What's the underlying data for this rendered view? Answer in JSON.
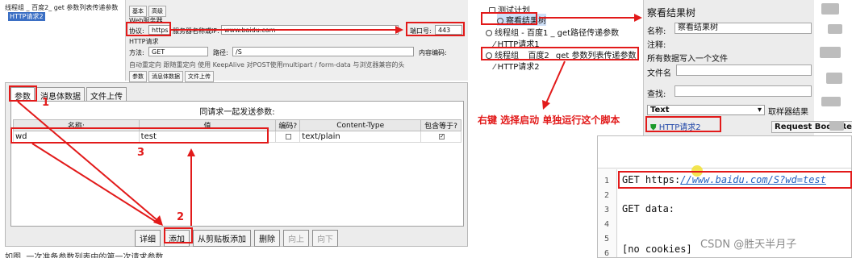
{
  "top_left_tree": {
    "items": [
      "线程组 _ 百度2_ get 参数列表传递参数",
      "HTTP请求2"
    ]
  },
  "config": {
    "tabs": [
      "基本",
      "高级"
    ],
    "web_server_label": "Web服务器",
    "protocol_label": "协议:",
    "protocol_value": "https",
    "server_label": "服务器名称或IP:",
    "server_value": "www.baidu.com",
    "port_label": "端口号:",
    "port_value": "443",
    "http_request_label": "HTTP请求",
    "method_label": "方法:",
    "method_value": "GET",
    "path_label": "路径:",
    "path_value": "/S",
    "encoding_label": "内容编码:",
    "options_text": "自动重定向  跟随重定向  使用 KeepAlive  对POST使用multipart / form-data  与浏览器兼容的头",
    "subtabs": [
      "参数",
      "消息体数据",
      "文件上传"
    ]
  },
  "params": {
    "tabs": [
      "参数",
      "消息体数据",
      "文件上传"
    ],
    "heading": "同请求一起发送参数:",
    "columns": [
      "名称:",
      "值",
      "编码?",
      "Content-Type",
      "包含等于?"
    ],
    "rows": [
      {
        "name": "wd",
        "value": "test",
        "encode": false,
        "content_type": "text/plain",
        "include_equals": true
      }
    ],
    "buttons": [
      "详细",
      "添加",
      "从剪贴板添加",
      "删除",
      "向上",
      "向下"
    ]
  },
  "annotations": {
    "n1": "1",
    "n2": "2",
    "n3": "3",
    "instruction": "右键  选择启动 单独运行这个脚本"
  },
  "tree": {
    "items": [
      {
        "label": "测试计划"
      },
      {
        "label": "察看结果树"
      },
      {
        "label": "线程组 - 百度1 _ get路径传递参数"
      },
      {
        "label": "HTTP请求1"
      },
      {
        "label": "线程组 _ 百度2_ get 参数列表传递参数"
      },
      {
        "label": "HTTP请求2"
      }
    ]
  },
  "result_tree": {
    "title": "察看结果树",
    "name_label": "名称:",
    "name_value": "察看结果树",
    "comment_label": "注释:",
    "write_all_label": "所有数据写入一个文件",
    "filename_label": "文件名",
    "search_label": "查找:",
    "renderer_value": "Text",
    "renderer_label": "取样器结果",
    "sample_label": "HTTP请求2",
    "tab_request_body": "Request Body",
    "tab_next": "Req"
  },
  "code": {
    "lines": [
      {
        "n": "1",
        "prefix": "GET https:",
        "url": "//www.baidu.com/S?wd=test"
      },
      {
        "n": "2",
        "prefix": "",
        "url": ""
      },
      {
        "n": "3",
        "prefix": "GET data:",
        "url": ""
      },
      {
        "n": "4",
        "prefix": "",
        "url": ""
      },
      {
        "n": "5",
        "prefix": "[no cookies]",
        "url": ""
      },
      {
        "n": "6",
        "prefix": "",
        "url": ""
      }
    ]
  },
  "watermark": "CSDN @胜天半月子",
  "bottom_caption": "如图, 一次准备参数列表中的第一次请求参数",
  "colors": {
    "annotation_red": "#e21a1a",
    "selection_blue": "#3b6fc4",
    "url_blue": "#2060c0"
  }
}
